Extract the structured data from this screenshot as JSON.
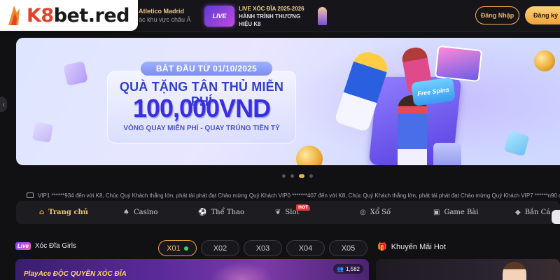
{
  "header": {
    "logo_text_brand": "K8",
    "logo_text_rest": "bet.red",
    "sponsor_line1": "Atletico Madrid",
    "sponsor_line2": "ác khu vực châu Á",
    "live_badge": "LIVE",
    "live_line1": "LIVE XÓC ĐĨA 2025-2026",
    "live_line2": "HÀNH TRÌNH THƯƠNG HIỆU K8",
    "login_label": "Đăng Nhập",
    "register_label": "Đăng ký"
  },
  "banner": {
    "date_text": "BẮT ĐẦU TỪ 01/10/2025",
    "title": "QUÀ TẶNG TÂN THỦ MIỄN PHÍ",
    "amount": "100,000VND",
    "subtitle": "VÒNG QUAY MIỄN PHÍ - QUAY TRÚNG TIỀN TỶ",
    "free_spins_label": "Free Spins",
    "slides_total": 4,
    "active_slide": 3
  },
  "marquee": {
    "text": "VIP1 ******934 đến với K8, Chúc Quý Khách thắng lớn, phát tài phát đạt Chào mừng Quý Khách VIP0 *******407 đến với K8, Chúc Quý Khách thắng lớn, phát tài phát đạt Chào mừng Quý Khách VIP7 ******n90 đế"
  },
  "nav": {
    "items": [
      {
        "label": "Trang chủ",
        "icon": "home-icon",
        "active": true
      },
      {
        "label": "Casino",
        "icon": "spade-icon"
      },
      {
        "label": "Thể Thao",
        "icon": "soccer-ball-icon"
      },
      {
        "label": "Slot",
        "icon": "cherry-icon",
        "badge": "HOT"
      },
      {
        "label": "Xổ Số",
        "icon": "lottery-ball-icon"
      },
      {
        "label": "Game Bài",
        "icon": "cards-icon"
      },
      {
        "label": "Bắn Cá",
        "icon": "fish-icon"
      }
    ]
  },
  "sections": {
    "left_badge": "Live",
    "left_title": "Xóc Đĩa Girls",
    "tabs": [
      "X01",
      "X02",
      "X03",
      "X04",
      "X05"
    ],
    "active_tab": "X01",
    "right_title": "Khuyến Mãi Hot",
    "game_title": "PlayAce ĐỘC QUYỀN XÓC ĐĨA",
    "viewer_count": "1,582"
  },
  "colors": {
    "accent": "#f3b35a",
    "brand_red": "#e3432a",
    "live_dot": "#3ad36a",
    "hot": "#e8333a"
  }
}
